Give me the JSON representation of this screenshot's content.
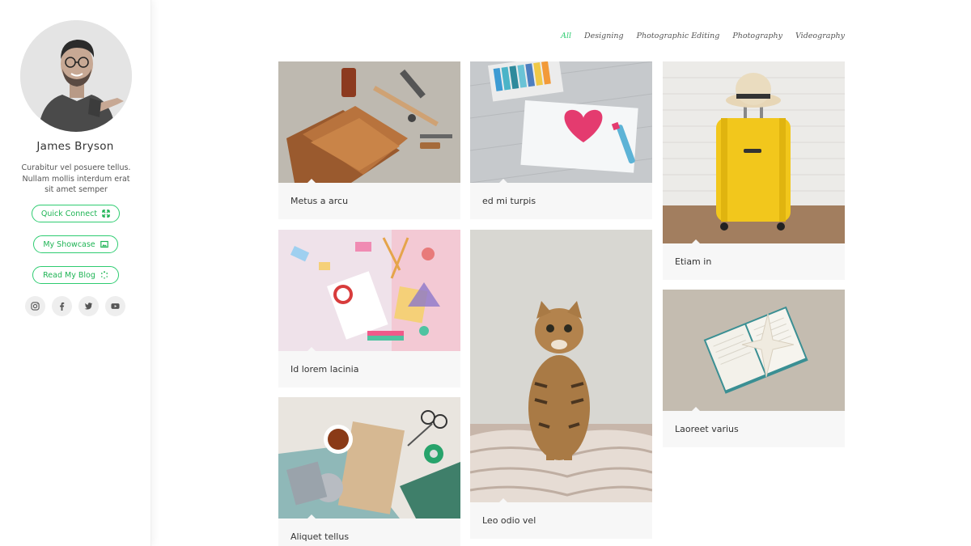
{
  "profile": {
    "name": "James Bryson",
    "bio": "Curabitur vel posuere tellus. Nullam mollis interdum erat sit amet semper",
    "buttons": [
      {
        "label": "Quick Connect",
        "icon": "expand-icon"
      },
      {
        "label": "My Showcase",
        "icon": "image-icon"
      },
      {
        "label": "Read My Blog",
        "icon": "spinner-icon"
      }
    ],
    "socials": [
      "instagram-icon",
      "facebook-icon",
      "twitter-icon",
      "youtube-icon"
    ]
  },
  "filters": [
    {
      "label": "All",
      "active": true
    },
    {
      "label": "Designing",
      "active": false
    },
    {
      "label": "Photographic Editing",
      "active": false
    },
    {
      "label": "Photography",
      "active": false
    },
    {
      "label": "Videography",
      "active": false
    }
  ],
  "portfolio": [
    {
      "title": "Metus a arcu",
      "image": "leather-craft-tools"
    },
    {
      "title": "ed mi turpis",
      "image": "heart-drawing-with-pastels"
    },
    {
      "title": "Etiam in",
      "image": "yellow-suitcase-with-hat"
    },
    {
      "title": "Id lorem lacinia",
      "image": "stationery-flatlay"
    },
    {
      "title": "Leo odio vel",
      "image": "tabby-cat"
    },
    {
      "title": "Laoreet varius",
      "image": "book-with-starfish-on-sand"
    },
    {
      "title": "Aliquet tellus",
      "image": "crafts-flatlay-with-tea"
    }
  ],
  "colors": {
    "accent": "#2ecc71",
    "card_bg": "#f7f7f7"
  }
}
